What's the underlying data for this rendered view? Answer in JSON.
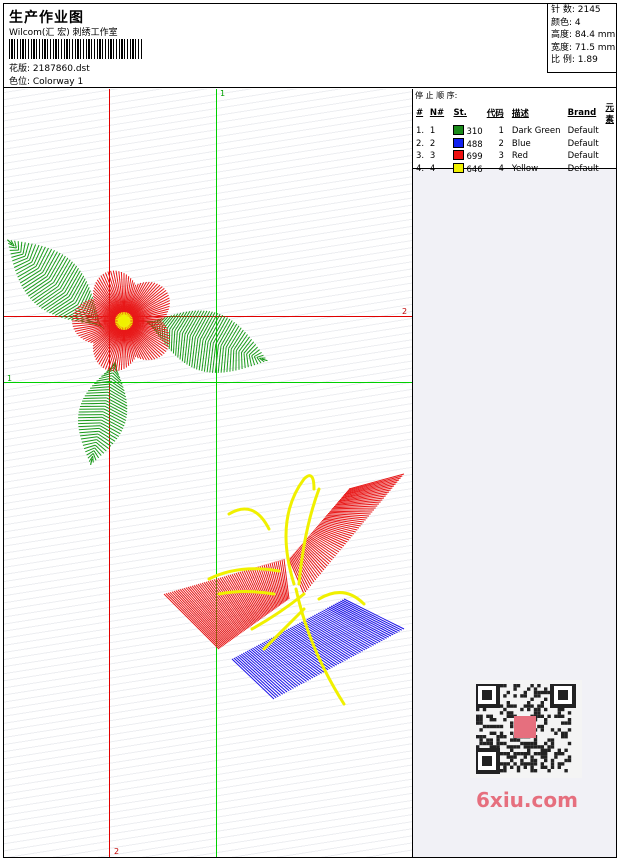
{
  "header": {
    "title": "生产作业图",
    "studio": "Wilcom(汇 宏) 刺绣工作室",
    "design_file": "花版: 2187860.dst",
    "colorway": "色位: Colorway 1"
  },
  "stats": {
    "stitches": "针 数: 2145",
    "colors": "颜色: 4",
    "height": "高度: 84.4 mm",
    "width": "宽度: 71.5 mm",
    "scale": "比 例: 1.89"
  },
  "stop_sequence": {
    "title": "停 止 顺 序:",
    "columns": [
      "#",
      "N#",
      "St.",
      "代码",
      "描述",
      "Brand",
      "元素"
    ],
    "rows": [
      {
        "idx": "1.",
        "n": "1",
        "color": "#1a8a1a",
        "st": "310",
        "code": "1",
        "desc": "Dark Green",
        "brand": "Default"
      },
      {
        "idx": "2.",
        "n": "2",
        "color": "#1020f0",
        "st": "488",
        "code": "2",
        "desc": "Blue",
        "brand": "Default"
      },
      {
        "idx": "3.",
        "n": "3",
        "color": "#ee1010",
        "st": "699",
        "code": "3",
        "desc": "Red",
        "brand": "Default"
      },
      {
        "idx": "4.",
        "n": "4",
        "color": "#f0f000",
        "st": "646",
        "code": "4",
        "desc": "Yellow",
        "brand": "Default"
      }
    ]
  },
  "axes": {
    "green_v_label": "1",
    "green_h_label": "1",
    "red_h_label": "2",
    "red_v_label": "2"
  },
  "watermark": "6xiu.com",
  "colors": {
    "green_thread": "#1a9a1a",
    "blue_thread": "#1a10e8",
    "red_thread": "#e81818",
    "yellow_thread": "#f0f000",
    "axis_green": "#00d000",
    "axis_red": "#e00000"
  }
}
